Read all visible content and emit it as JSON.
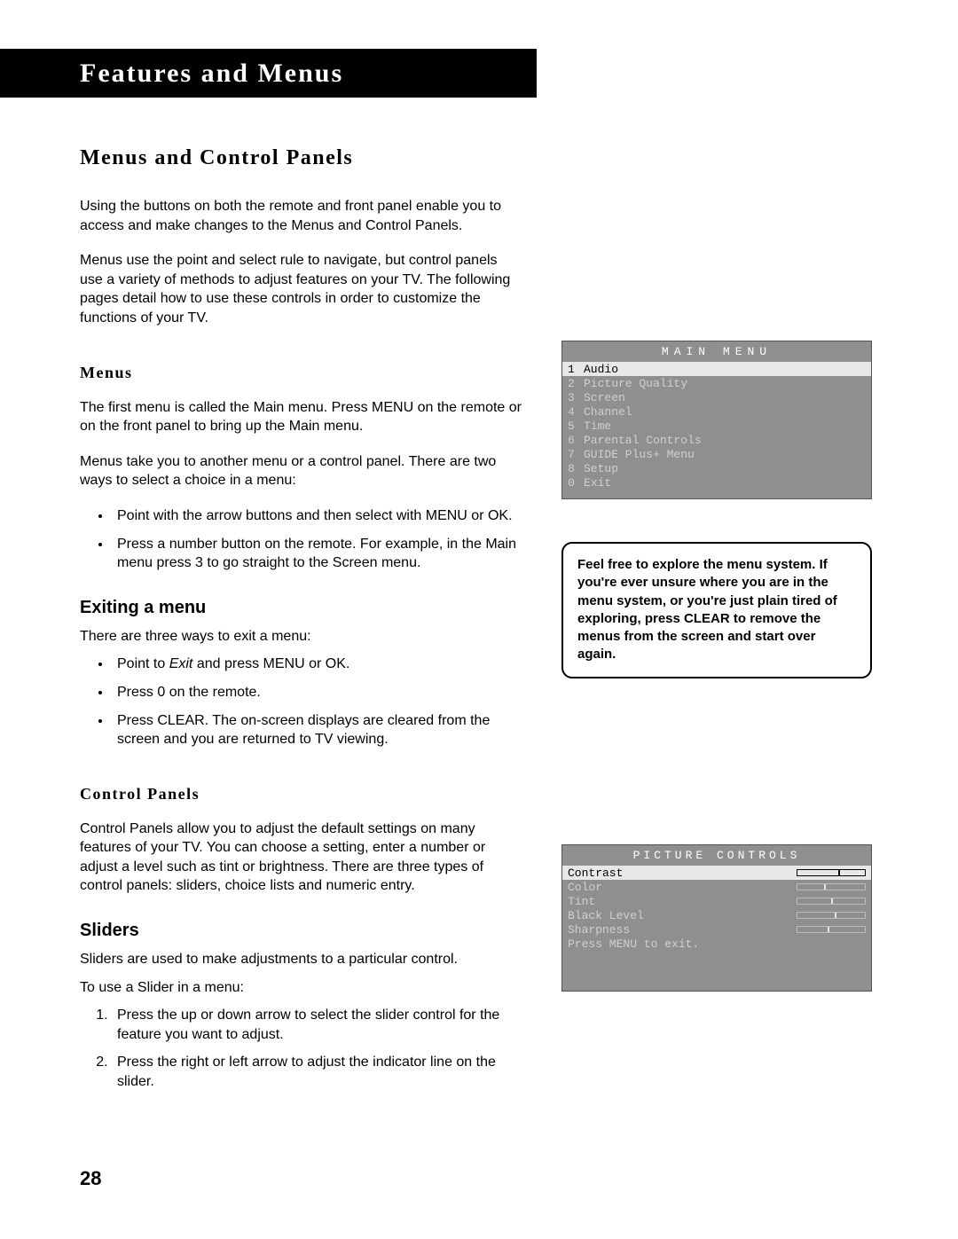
{
  "page_number": "28",
  "header_bar": "Features and Menus",
  "h1": "Menus and Control Panels",
  "intro_p1": "Using the buttons on both the remote and front panel enable you to access and make changes to the Menus and Control Panels.",
  "intro_p2": "Menus use the point and select rule to navigate, but control panels use a variety of methods to adjust features on your TV. The following pages detail how to use these controls in order to customize the functions of your TV.",
  "menus": {
    "heading": "Menus",
    "p1": "The first menu is called the Main menu. Press MENU on the remote or on the front panel to bring up the Main menu.",
    "p2": "Menus take you to another menu or a control panel. There are two ways to select a choice in a menu:",
    "bullets": [
      "Point with the arrow buttons and then select with MENU or OK.",
      "Press a number button on the remote. For example, in the Main menu press 3 to go straight to the Screen menu."
    ]
  },
  "exiting": {
    "heading": "Exiting a menu",
    "p1": "There are three ways to exit a menu:",
    "bullets_a": "Point to ",
    "bullets_a_em": "Exit",
    "bullets_a2": " and press MENU or OK.",
    "bullets_b": "Press 0 on the remote.",
    "bullets_c": "Press CLEAR. The on-screen displays are cleared from the screen and you are returned to TV viewing."
  },
  "control_panels": {
    "heading": "Control Panels",
    "p1": "Control Panels allow you to adjust the default settings on many features of your TV. You can choose a setting, enter a number or adjust a level such as tint or brightness. There are three types of control panels: sliders, choice lists and numeric entry."
  },
  "sliders": {
    "heading": "Sliders",
    "p1": "Sliders are used to make adjustments to a particular control.",
    "p2": "To use a Slider in a menu:",
    "steps": [
      "Press the up or down arrow to select the slider control for the feature you want to adjust.",
      "Press the right or left arrow to adjust the indicator line on the slider."
    ]
  },
  "main_menu_osd": {
    "title": "MAIN MENU",
    "items": [
      {
        "n": "1",
        "label": "Audio",
        "sel": true
      },
      {
        "n": "2",
        "label": "Picture Quality",
        "sel": false
      },
      {
        "n": "3",
        "label": "Screen",
        "sel": false
      },
      {
        "n": "4",
        "label": "Channel",
        "sel": false
      },
      {
        "n": "5",
        "label": "Time",
        "sel": false
      },
      {
        "n": "6",
        "label": "Parental Controls",
        "sel": false
      },
      {
        "n": "7",
        "label": "GUIDE Plus+ Menu",
        "sel": false
      },
      {
        "n": "8",
        "label": "Setup",
        "sel": false
      },
      {
        "n": "0",
        "label": "Exit",
        "sel": false
      }
    ]
  },
  "tip_box": "Feel free to explore the menu system. If you're ever unsure where you are in the menu system, or you're just plain tired of exploring, press CLEAR to remove the menus from the screen and start over again.",
  "picture_osd": {
    "title": "PICTURE CONTROLS",
    "items": [
      {
        "label": "Contrast",
        "pos": 60,
        "sel": true
      },
      {
        "label": "Color",
        "pos": 40,
        "sel": false
      },
      {
        "label": "Tint",
        "pos": 50,
        "sel": false
      },
      {
        "label": "Black Level",
        "pos": 55,
        "sel": false
      },
      {
        "label": "Sharpness",
        "pos": 45,
        "sel": false
      }
    ],
    "footer": "Press MENU to exit."
  }
}
